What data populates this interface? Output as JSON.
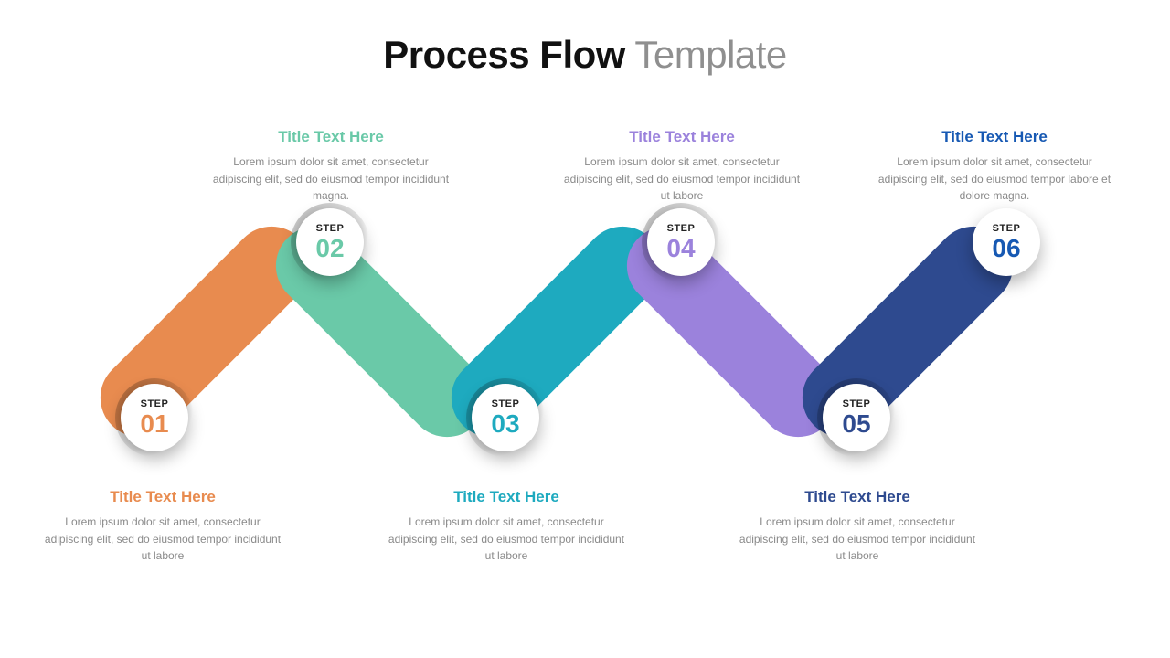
{
  "title": {
    "bold": "Process Flow",
    "light": " Template"
  },
  "stepLabel": "STEP",
  "colors": {
    "s1": "#e88b4f",
    "s2": "#6ac9a8",
    "s3": "#1eaabf",
    "s4": "#9b82dc",
    "s5": "#2e4a8f",
    "s6": "#1759b3"
  },
  "steps": [
    {
      "num": "01",
      "title": "Title Text Here",
      "body": "Lorem ipsum dolor sit amet, consectetur adipiscing elit, sed do eiusmod tempor incididunt ut labore"
    },
    {
      "num": "02",
      "title": "Title Text Here",
      "body": "Lorem ipsum dolor sit amet, consectetur adipiscing elit, sed do eiusmod tempor incididunt magna."
    },
    {
      "num": "03",
      "title": "Title Text Here",
      "body": "Lorem ipsum dolor sit amet, consectetur adipiscing elit, sed do eiusmod tempor incididunt ut labore"
    },
    {
      "num": "04",
      "title": "Title Text Here",
      "body": "Lorem ipsum dolor sit amet, consectetur adipiscing elit, sed do eiusmod tempor incididunt ut labore"
    },
    {
      "num": "05",
      "title": "Title Text Here",
      "body": "Lorem ipsum dolor sit amet, consectetur adipiscing elit, sed do eiusmod tempor incididunt ut labore"
    },
    {
      "num": "06",
      "title": "Title Text Here",
      "body": "Lorem ipsum dolor sit amet, consectetur adipiscing elit, sed do eiusmod tempor labore et dolore magna."
    }
  ]
}
